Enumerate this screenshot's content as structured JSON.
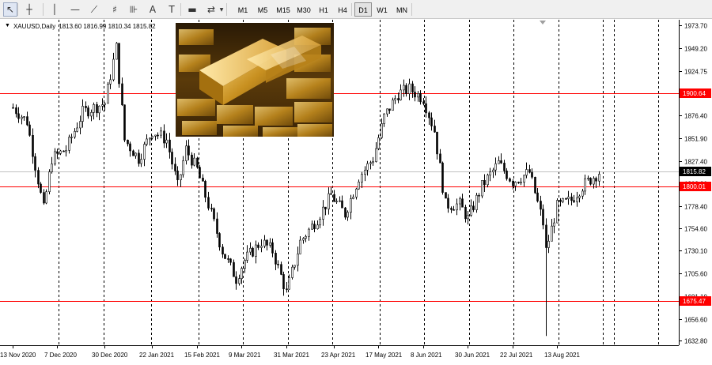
{
  "toolbar": {
    "tools": [
      {
        "name": "cursor-icon",
        "glyph": "↖",
        "active": true
      },
      {
        "name": "crosshair-icon",
        "glyph": "┼",
        "active": false
      },
      {
        "name": "vertical-line-icon",
        "glyph": "│",
        "active": false
      },
      {
        "name": "horizontal-line-icon",
        "glyph": "—",
        "active": false
      },
      {
        "name": "trendline-icon",
        "glyph": "⟋",
        "active": false
      },
      {
        "name": "fibonacci-icon",
        "glyph": "♯",
        "active": false
      },
      {
        "name": "fibo-fan-icon",
        "glyph": "⊪",
        "active": false
      },
      {
        "name": "text-icon",
        "glyph": "A",
        "active": false
      },
      {
        "name": "text-label-icon",
        "glyph": "T",
        "active": false
      },
      {
        "name": "rectangle-icon",
        "glyph": "▬",
        "active": false
      },
      {
        "name": "shapes-menu-icon",
        "glyph": "⇄",
        "active": false
      }
    ],
    "timeframes": [
      "M1",
      "M5",
      "M15",
      "M30",
      "H1",
      "H4",
      "D1",
      "W1",
      "MN"
    ],
    "active_timeframe": "D1"
  },
  "symbol": {
    "label": "XAUUSD,Daily",
    "ohlc": "1813.60 1816.99 1810.34 1815.82"
  },
  "chart_data": {
    "type": "candlestick",
    "symbol": "XAUUSD",
    "timeframe": "Daily",
    "ylim": [
      1628,
      1980
    ],
    "y_ticks": [
      "1973.70",
      "1949.20",
      "1924.75",
      "1900.25",
      "1876.40",
      "1851.90",
      "1827.40",
      "1802.90",
      "1778.40",
      "1754.60",
      "1730.10",
      "1705.60",
      "1681.10",
      "1656.60",
      "1632.80"
    ],
    "x_ticks": [
      "13 Nov 2020",
      "7 Dec 2020",
      "30 Dec 2020",
      "22 Jan 2021",
      "15 Feb 2021",
      "9 Mar 2021",
      "31 Mar 2021",
      "23 Apr 2021",
      "17 May 2021",
      "8 Jun 2021",
      "30 Jun 2021",
      "22 Jul 2021",
      "13 Aug 2021"
    ],
    "grid": "vertical-dashed",
    "levels": [
      {
        "value": 1900.64,
        "label": "1900.64",
        "color": "#ff0000"
      },
      {
        "value": 1800.01,
        "label": "1800.01",
        "color": "#ff0000"
      },
      {
        "value": 1675.47,
        "label": "1675.47",
        "color": "#ff0000"
      }
    ],
    "current_price": {
      "value": 1815.82,
      "label": "1815.82"
    },
    "anchors": [
      {
        "date": "13 Nov 2020",
        "price": 1885
      },
      {
        "date": "20 Nov 2020",
        "price": 1870
      },
      {
        "date": "30 Nov 2020",
        "price": 1775
      },
      {
        "date": "3 Dec 2020",
        "price": 1830
      },
      {
        "date": "10 Dec 2020",
        "price": 1840
      },
      {
        "date": "18 Dec 2020",
        "price": 1880
      },
      {
        "date": "30 Dec 2020",
        "price": 1890
      },
      {
        "date": "5 Jan 2021",
        "price": 1950
      },
      {
        "date": "8 Jan 2021",
        "price": 1850
      },
      {
        "date": "15 Jan 2021",
        "price": 1830
      },
      {
        "date": "22 Jan 2021",
        "price": 1860
      },
      {
        "date": "29 Jan 2021",
        "price": 1850
      },
      {
        "date": "4 Feb 2021",
        "price": 1800
      },
      {
        "date": "9 Feb 2021",
        "price": 1840
      },
      {
        "date": "15 Feb 2021",
        "price": 1818
      },
      {
        "date": "19 Feb 2021",
        "price": 1780
      },
      {
        "date": "26 Feb 2021",
        "price": 1730
      },
      {
        "date": "5 Mar 2021",
        "price": 1700
      },
      {
        "date": "10 Mar 2021",
        "price": 1720
      },
      {
        "date": "18 Mar 2021",
        "price": 1740
      },
      {
        "date": "24 Mar 2021",
        "price": 1730
      },
      {
        "date": "31 Mar 2021",
        "price": 1685
      },
      {
        "date": "7 Apr 2021",
        "price": 1740
      },
      {
        "date": "15 Apr 2021",
        "price": 1765
      },
      {
        "date": "22 Apr 2021",
        "price": 1790
      },
      {
        "date": "29 Apr 2021",
        "price": 1770
      },
      {
        "date": "6 May 2021",
        "price": 1810
      },
      {
        "date": "13 May 2021",
        "price": 1830
      },
      {
        "date": "19 May 2021",
        "price": 1875
      },
      {
        "date": "26 May 2021",
        "price": 1900
      },
      {
        "date": "1 Jun 2021",
        "price": 1905
      },
      {
        "date": "8 Jun 2021",
        "price": 1895
      },
      {
        "date": "14 Jun 2021",
        "price": 1860
      },
      {
        "date": "18 Jun 2021",
        "price": 1780
      },
      {
        "date": "25 Jun 2021",
        "price": 1780
      },
      {
        "date": "30 Jun 2021",
        "price": 1765
      },
      {
        "date": "7 Jul 2021",
        "price": 1800
      },
      {
        "date": "15 Jul 2021",
        "price": 1825
      },
      {
        "date": "22 Jul 2021",
        "price": 1805
      },
      {
        "date": "30 Jul 2021",
        "price": 1815
      },
      {
        "date": "6 Aug 2021",
        "price": 1760
      },
      {
        "date": "9 Aug 2021",
        "price": 1730
      },
      {
        "date": "13 Aug 2021",
        "price": 1778
      },
      {
        "date": "20 Aug 2021",
        "price": 1785
      },
      {
        "date": "26 Aug 2021",
        "price": 1800
      },
      {
        "date": "3 Sep 2021",
        "price": 1815
      }
    ],
    "spike_low": {
      "date": "9 Aug 2021",
      "price": 1638
    },
    "colors": {
      "candles": "#000000",
      "grid": "#000000",
      "background": "#ffffff"
    }
  }
}
